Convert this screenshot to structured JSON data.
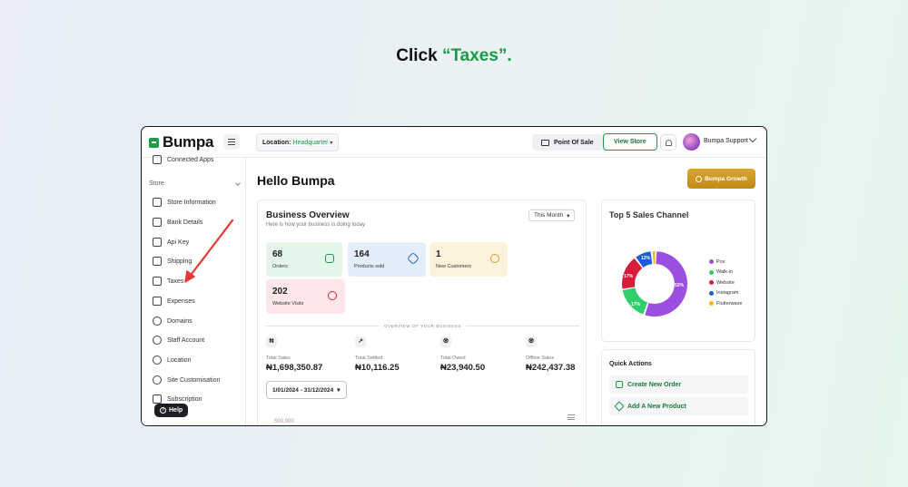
{
  "instruction": {
    "prefix": "Click ",
    "target": "“Taxes”."
  },
  "topbar": {
    "brand": "Bumpa",
    "location_label": "Location:",
    "location_value": "Headquarter",
    "location_caret": "▾",
    "point_of_sale": "Point Of Sale",
    "view_store": "View Store",
    "account": "Bumpa Support"
  },
  "sidebar": {
    "connected_apps": "Connected Apps",
    "section": "Store",
    "items": [
      {
        "label": "Store Information",
        "icon": "store-icon"
      },
      {
        "label": "Bank Details",
        "icon": "bank-icon"
      },
      {
        "label": "Api Key",
        "icon": "api-icon"
      },
      {
        "label": "Shipping",
        "icon": "truck-icon"
      },
      {
        "label": "Taxes",
        "icon": "taxes-icon"
      },
      {
        "label": "Expenses",
        "icon": "expenses-icon"
      },
      {
        "label": "Domains",
        "icon": "globe-icon"
      },
      {
        "label": "Staff Account",
        "icon": "staff-icon"
      },
      {
        "label": "Location",
        "icon": "location-icon"
      },
      {
        "label": "Site Customisation",
        "icon": "palette-icon"
      },
      {
        "label": "Subscription",
        "icon": "layers-icon"
      }
    ],
    "help": "Help"
  },
  "main": {
    "greeting": "Hello Bumpa",
    "growth_button": "Bumpa Growth",
    "overview": {
      "title": "Business Overview",
      "subtitle": "Here is how your business is doing today",
      "period": "This Month",
      "tiles": [
        {
          "value": "68",
          "label": "Orders"
        },
        {
          "value": "164",
          "label": "Products sold"
        },
        {
          "value": "1",
          "label": "New Customers"
        },
        {
          "value": "202",
          "label": "Website Visits"
        }
      ],
      "divider": "OVERVIEW OF YOUR BUSINESS",
      "stats": [
        {
          "label": "Total Sales",
          "value": "₦1,698,350.87",
          "icon": "₦"
        },
        {
          "label": "Total Settled",
          "value": "₦10,116.25",
          "icon": "↗"
        },
        {
          "label": "Total Owed",
          "value": "₦23,940.50",
          "icon": "♼"
        },
        {
          "label": "Offline Sales",
          "value": "₦242,437.38",
          "icon": "♼"
        }
      ],
      "date_range": "1/01/2024 - 31/12/2024",
      "y_tick": "500,000"
    },
    "sales_channel": {
      "title": "Top 5 Sales Channel",
      "labels": {
        "pos": "52%",
        "walkin": "17%",
        "website": "17%",
        "instagram": "12%"
      },
      "legend": [
        "Pos",
        "Walk-in",
        "Website",
        "Instagram",
        "Flutterwave"
      ],
      "colors": [
        "#9b4fe0",
        "#2fcf6b",
        "#d81d3b",
        "#1e5bd6",
        "#f3b51a"
      ]
    },
    "quick_actions": {
      "title": "Quick Actions",
      "items": [
        "Create New Order",
        "Add A New Product"
      ]
    }
  }
}
